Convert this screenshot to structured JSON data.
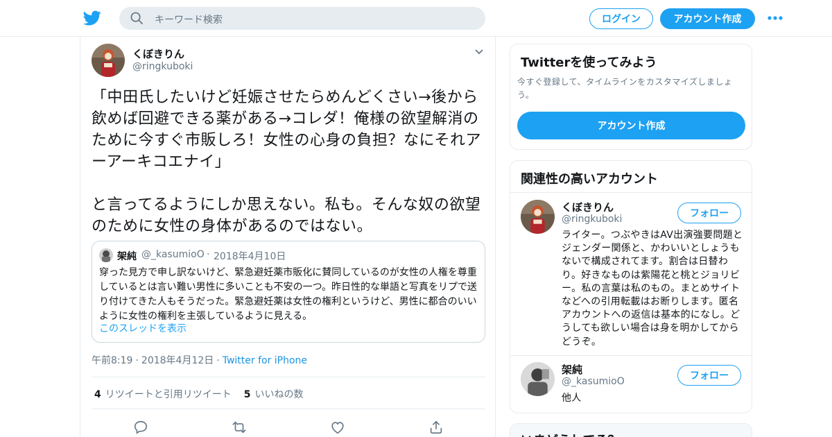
{
  "colors": {
    "accent": "#1da1f2",
    "muted": "#657786",
    "border": "#e6ecf0"
  },
  "header": {
    "search_placeholder": "キーワード検索",
    "login_label": "ログイン",
    "signup_label": "アカウント作成"
  },
  "tweet": {
    "name": "くぼきりん",
    "handle": "@ringkuboki",
    "text": "「中田氏したいけど妊娠させたらめんどくさい→後から飲めば回避できる薬がある→コレダ！俺様の欲望解消のために今すぐ市販しろ！女性の心身の負担？なにそれアーアーキコエナイ」\n\nと言ってるようにしか思えない。私も。そんな奴の欲望のために女性の身体があるのではない。",
    "quote": {
      "name": "架純",
      "handle": "@_kasumioO",
      "separator": "·",
      "date": "2018年4月10日",
      "text": "穿った見方で申し訳ないけど、緊急避妊薬市販化に賛同しているのが女性の人権を尊重しているとは言い難い男性に多いことも不安の一つ。昨日性的な単語と写真をリプで送り付けてきた人もそうだった。緊急避妊薬は女性の権利というけど、男性に都合のいいように女性の権利を主張しているように見える。",
      "thread_link": "このスレッドを表示"
    },
    "time": "午前8:19",
    "date": "2018年4月12日",
    "source": "Twitter for iPhone",
    "separator": "·",
    "retweet_count": "4",
    "retweet_label": "リツイートと引用リツイート",
    "like_count": "5",
    "like_label": "いいねの数"
  },
  "sidebar": {
    "signup_card": {
      "title": "Twitterを使ってみよう",
      "description": "今すぐ登録して、タイムラインをカスタマイズしましょう。",
      "button": "アカウント作成"
    },
    "related": {
      "title": "関連性の高いアカウント",
      "follow_label": "フォロー",
      "accounts": [
        {
          "name": "くぼきりん",
          "handle": "@ringkuboki",
          "bio": "ライター。つぶやきはAV出演強要問題とジェンダー関係と、かわいいとしょうもないで構成されてます。割合は日替わり。好きなものは紫陽花と桃とジョリビー。私の言葉は私のもの。まとめサイトなどへの引用転載はお断りします。匿名アカウントへの返信は基本的になし。どうしても欲しい場合は身を明かしてからどうぞ。"
        },
        {
          "name": "架純",
          "handle": "@_kasumioO",
          "bio": "他人"
        }
      ]
    },
    "trends_title": "いまどうしてる？"
  }
}
